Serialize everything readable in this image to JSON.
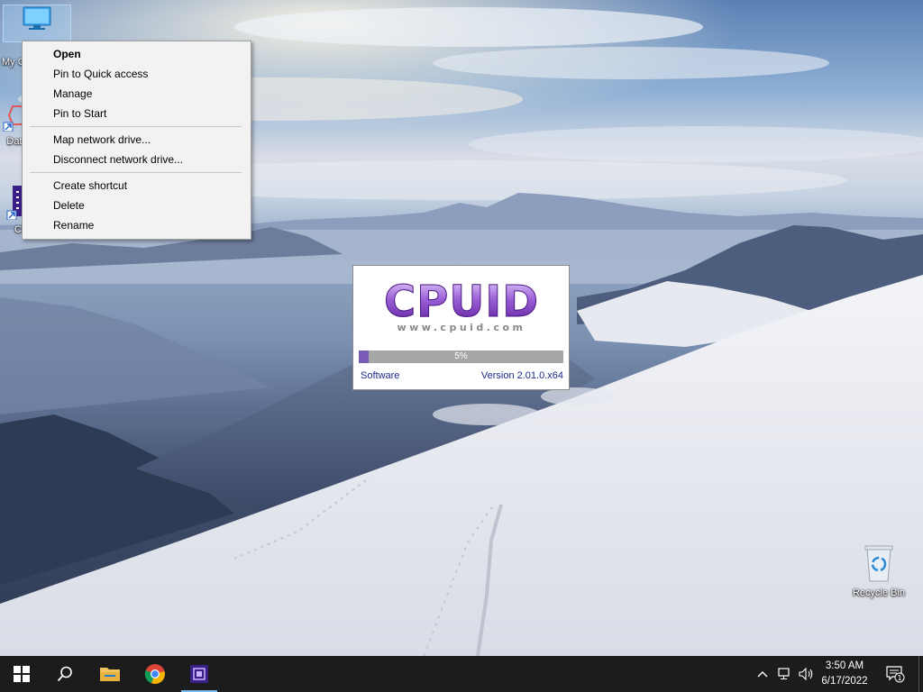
{
  "desktop": {
    "icons": [
      {
        "label": "My C"
      },
      {
        "label": "Data"
      },
      {
        "label": "CPUID CPU-Z"
      },
      {
        "label": "Recycle Bin"
      }
    ]
  },
  "context_menu": {
    "items": [
      {
        "label": "Open",
        "bold": true
      },
      {
        "label": "Pin to Quick access"
      },
      {
        "label": "Manage"
      },
      {
        "label": "Pin to Start"
      },
      {
        "separator": true
      },
      {
        "label": "Map network drive..."
      },
      {
        "label": "Disconnect network drive..."
      },
      {
        "separator": true
      },
      {
        "label": "Create shortcut"
      },
      {
        "label": "Delete"
      },
      {
        "label": "Rename"
      }
    ]
  },
  "splash": {
    "logo_text": "CPUID",
    "logo_url_text": "www.cpuid.com",
    "progress_label": "5%",
    "progress_value": 0.05,
    "software_label": "Software",
    "version_label": "Version 2.01.0.x64"
  },
  "taskbar": {
    "time": "3:50 AM",
    "date": "6/17/2022",
    "notification_count": "1",
    "apps": [
      "start-button",
      "search-button",
      "file-explorer",
      "chrome",
      "cpu-z"
    ]
  },
  "colors": {
    "taskbar": "#1c1c1c",
    "progress_fill": "#7a5bb5",
    "splash_text": "#1a2a8a"
  }
}
